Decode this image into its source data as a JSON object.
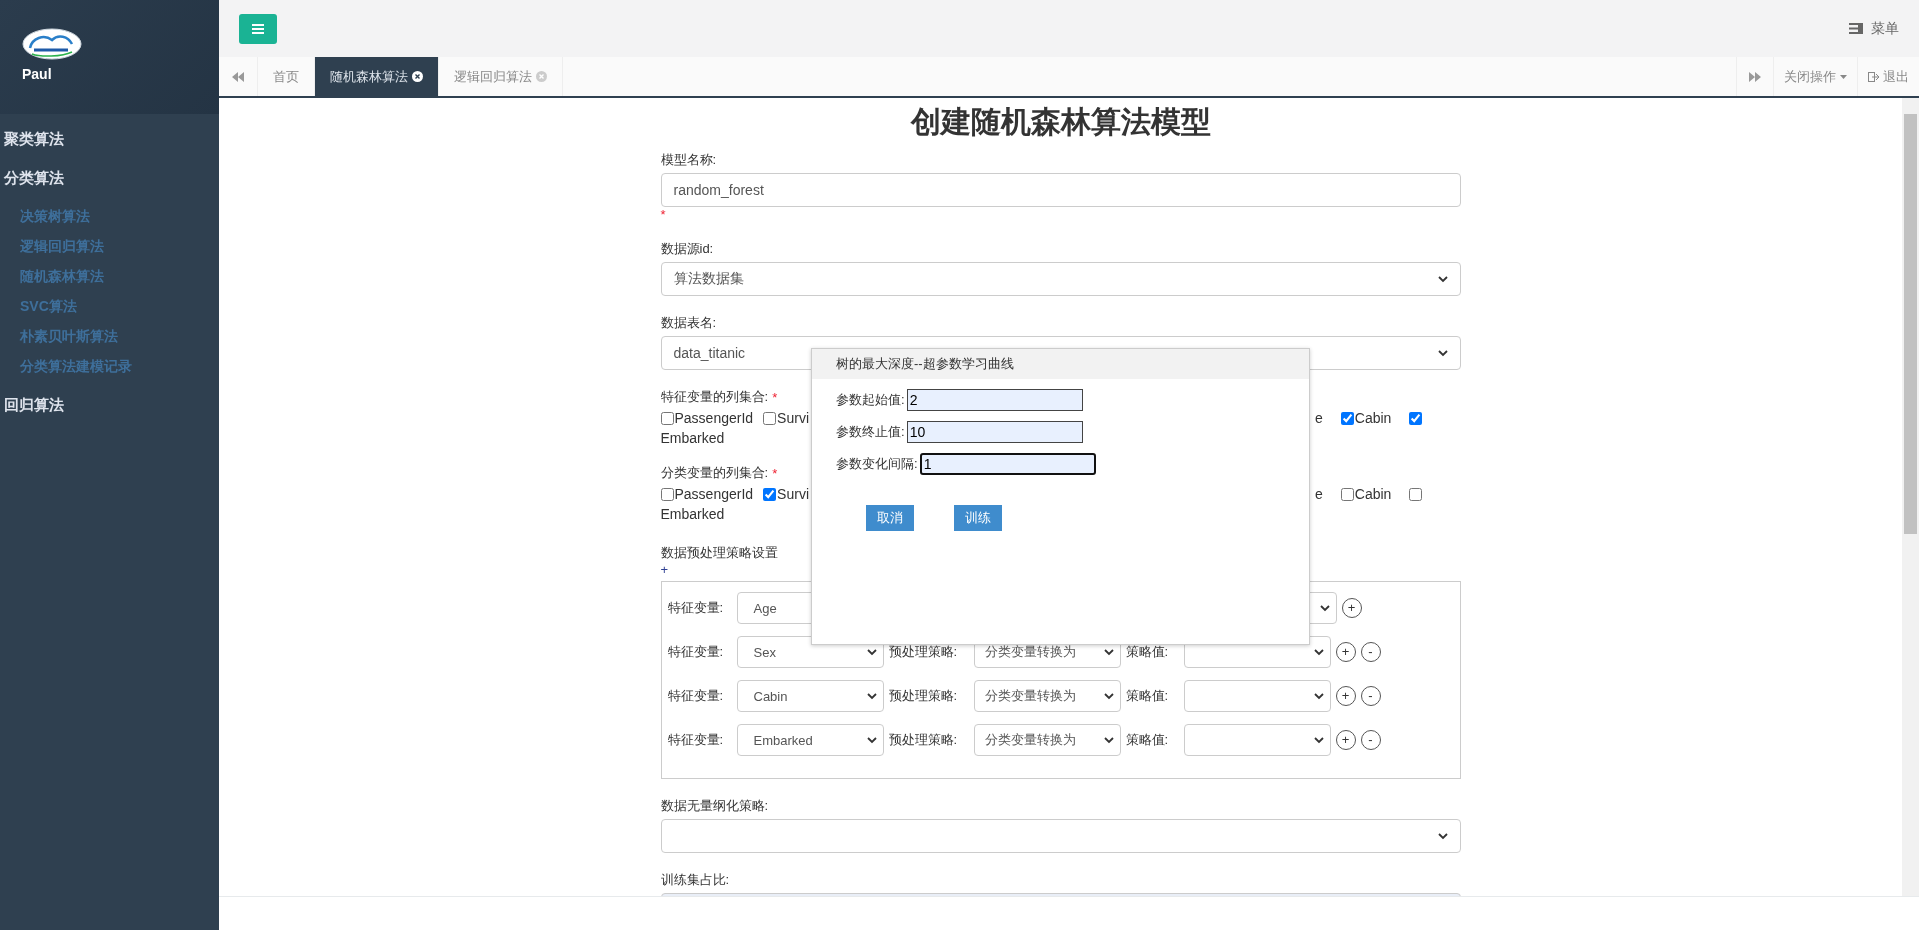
{
  "sidebar": {
    "user": "Paul",
    "menu": [
      {
        "label": "聚类算法"
      },
      {
        "label": "分类算法",
        "children": [
          {
            "label": "决策树算法"
          },
          {
            "label": "逻辑回归算法"
          },
          {
            "label": "随机森林算法"
          },
          {
            "label": "SVC算法"
          },
          {
            "label": "朴素贝叶斯算法"
          },
          {
            "label": "分类算法建模记录"
          }
        ]
      },
      {
        "label": "回归算法"
      }
    ]
  },
  "topbar": {
    "menu_label": "菜单"
  },
  "tabs": [
    {
      "label": "首页",
      "selected": false,
      "closable": false
    },
    {
      "label": "随机森林算法",
      "selected": true,
      "closable": true
    },
    {
      "label": "逻辑回归算法",
      "selected": false,
      "closable": true
    }
  ],
  "tab_actions": {
    "close_ops": "关闭操作",
    "logout": "退出"
  },
  "form": {
    "title": "创建随机森林算法模型",
    "sections": [
      {
        "kind": "input",
        "label": "模型名称:",
        "value": "random_forest",
        "note": "*"
      },
      {
        "kind": "select",
        "label": "数据源id:",
        "value": "算法数据集"
      },
      {
        "kind": "select",
        "label": "数据表名:",
        "value": "data_titanic"
      },
      {
        "kind": "checks",
        "label": "特征变量的列集合:",
        "mark": "*",
        "left": [
          {
            "label": "PassengerId",
            "checked": false
          },
          {
            "label": "Survi",
            "checked": false
          }
        ],
        "fragment": "e",
        "right": [
          {
            "label": "Cabin",
            "checked": true
          },
          {
            "label": "Embarked",
            "checked": true
          }
        ]
      },
      {
        "kind": "checks",
        "label": "分类变量的列集合:",
        "mark": "*",
        "left": [
          {
            "label": "PassengerId",
            "checked": false
          },
          {
            "label": "Survi",
            "checked": true
          }
        ],
        "fragment": "e",
        "right": [
          {
            "label": "Cabin",
            "checked": false
          },
          {
            "label": "Embarked",
            "checked": false
          }
        ]
      },
      {
        "kind": "strategy",
        "label": "数据预处理策略设置",
        "add": "+",
        "rows": [
          {
            "kind": "covered",
            "feature_label": "特征变量:",
            "feature": "Age",
            "add": "+"
          },
          {
            "kind": "full",
            "feature_label": "特征变量:",
            "feature": "Sex",
            "strategy_label": "预处理策略:",
            "strategy": "分类变量转换为",
            "value_label": "策略值:",
            "add": "+",
            "remove": "-"
          },
          {
            "kind": "full",
            "feature_label": "特征变量:",
            "feature": "Cabin",
            "strategy_label": "预处理策略:",
            "strategy": "分类变量转换为",
            "value_label": "策略值:",
            "add": "+",
            "remove": "-"
          },
          {
            "kind": "full",
            "feature_label": "特征变量:",
            "feature": "Embarked",
            "strategy_label": "预处理策略:",
            "strategy": "分类变量转换为",
            "value_label": "策略值:",
            "add": "+",
            "remove": "-"
          }
        ]
      },
      {
        "kind": "select",
        "label": "数据无量纲化策略:"
      },
      {
        "kind": "shaded",
        "label": "训练集占比:"
      }
    ]
  },
  "dialog": {
    "title": "树的最大深度--超参数学习曲线",
    "fields": [
      {
        "label": "参数起始值:",
        "value": "2",
        "focused": false
      },
      {
        "label": "参数终止值:",
        "value": "10",
        "focused": false
      },
      {
        "label": "参数变化间隔:",
        "value": "1",
        "focused": true
      }
    ],
    "buttons": [
      "取消",
      "训练"
    ]
  }
}
